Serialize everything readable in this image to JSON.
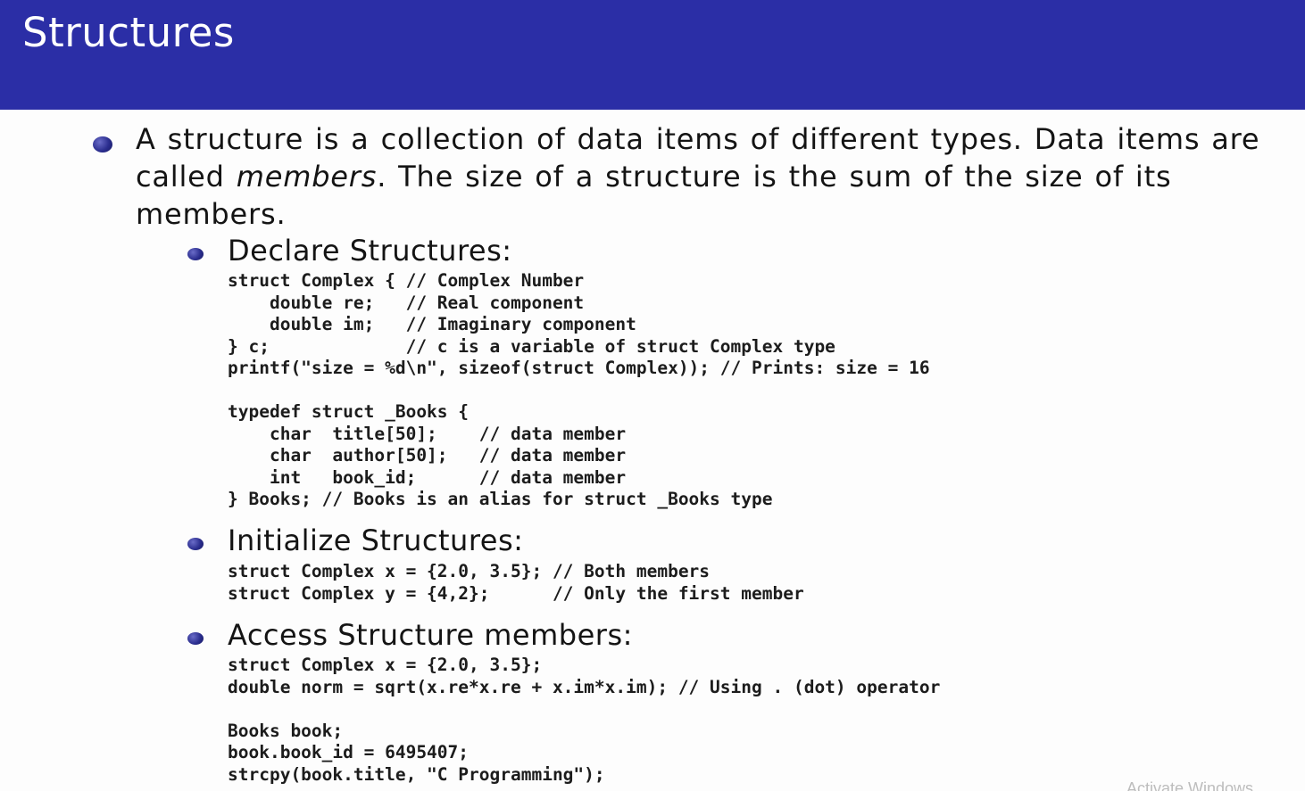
{
  "slide": {
    "title": "Structures"
  },
  "intro": {
    "text_1": "A structure is a collection of data items of different types. Data items are called ",
    "emphasis": "members",
    "text_2": ". The size of a structure is the sum of the size of its members."
  },
  "sections": {
    "declare": {
      "heading": "Declare Structures:",
      "code": "struct Complex { // Complex Number\n    double re;   // Real component\n    double im;   // Imaginary component\n} c;             // c is a variable of struct Complex type\nprintf(\"size = %d\\n\", sizeof(struct Complex)); // Prints: size = 16\n\ntypedef struct _Books {\n    char  title[50];    // data member\n    char  author[50];   // data member\n    int   book_id;      // data member\n} Books; // Books is an alias for struct _Books type"
    },
    "initialize": {
      "heading": "Initialize Structures:",
      "code": "struct Complex x = {2.0, 3.5}; // Both members\nstruct Complex y = {4,2};      // Only the first member"
    },
    "access": {
      "heading": "Access Structure members:",
      "code": "struct Complex x = {2.0, 3.5};\ndouble norm = sqrt(x.re*x.re + x.im*x.im); // Using . (dot) operator\n\nBooks book;\nbook.book_id = 6495407;\nstrcpy(book.title, \"C Programming\");"
    }
  },
  "overlay": {
    "watermark": "Activate Windows"
  }
}
